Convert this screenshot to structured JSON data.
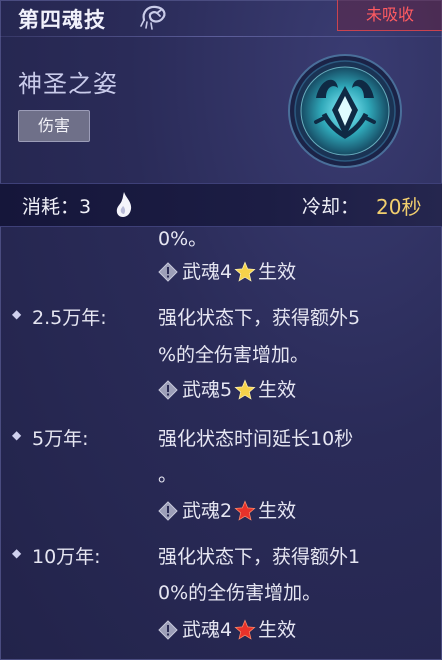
{
  "header": {
    "title": "第四魂技",
    "status": "未吸收"
  },
  "skill": {
    "name": "神圣之姿",
    "tag": "伤害"
  },
  "info": {
    "cost_label": "消耗：3",
    "cooldown_label": "冷却：",
    "cooldown_value": "20秒"
  },
  "levels": [
    {
      "year": "",
      "lines": [
        "0%。"
      ],
      "req_prefix": "武魂4",
      "req_star": "gold",
      "req_suffix": "生效"
    },
    {
      "year": "2.5万年:",
      "lines": [
        "强化状态下，获得额外5",
        "%的全伤害增加。"
      ],
      "req_prefix": "武魂5",
      "req_star": "gold",
      "req_suffix": "生效"
    },
    {
      "year": "5万年:",
      "lines": [
        "强化状态时间延长10秒",
        "。"
      ],
      "req_prefix": "武魂2",
      "req_star": "red",
      "req_suffix": "生效"
    },
    {
      "year": "10万年:",
      "lines": [
        "强化状态下，获得额外1",
        "0%的全伤害增加。"
      ],
      "req_prefix": "武魂4",
      "req_star": "red",
      "req_suffix": "生效"
    }
  ],
  "colors": {
    "status_red": "#ff5b61",
    "cooldown_gold": "#f2cf6e",
    "star_gold": "#f6d24a",
    "star_red": "#e8322a"
  },
  "icons": [
    "scorpion-icon",
    "skill-emblem-icon",
    "soul-flame-icon",
    "exclamation-diamond-icon",
    "star-icon"
  ]
}
